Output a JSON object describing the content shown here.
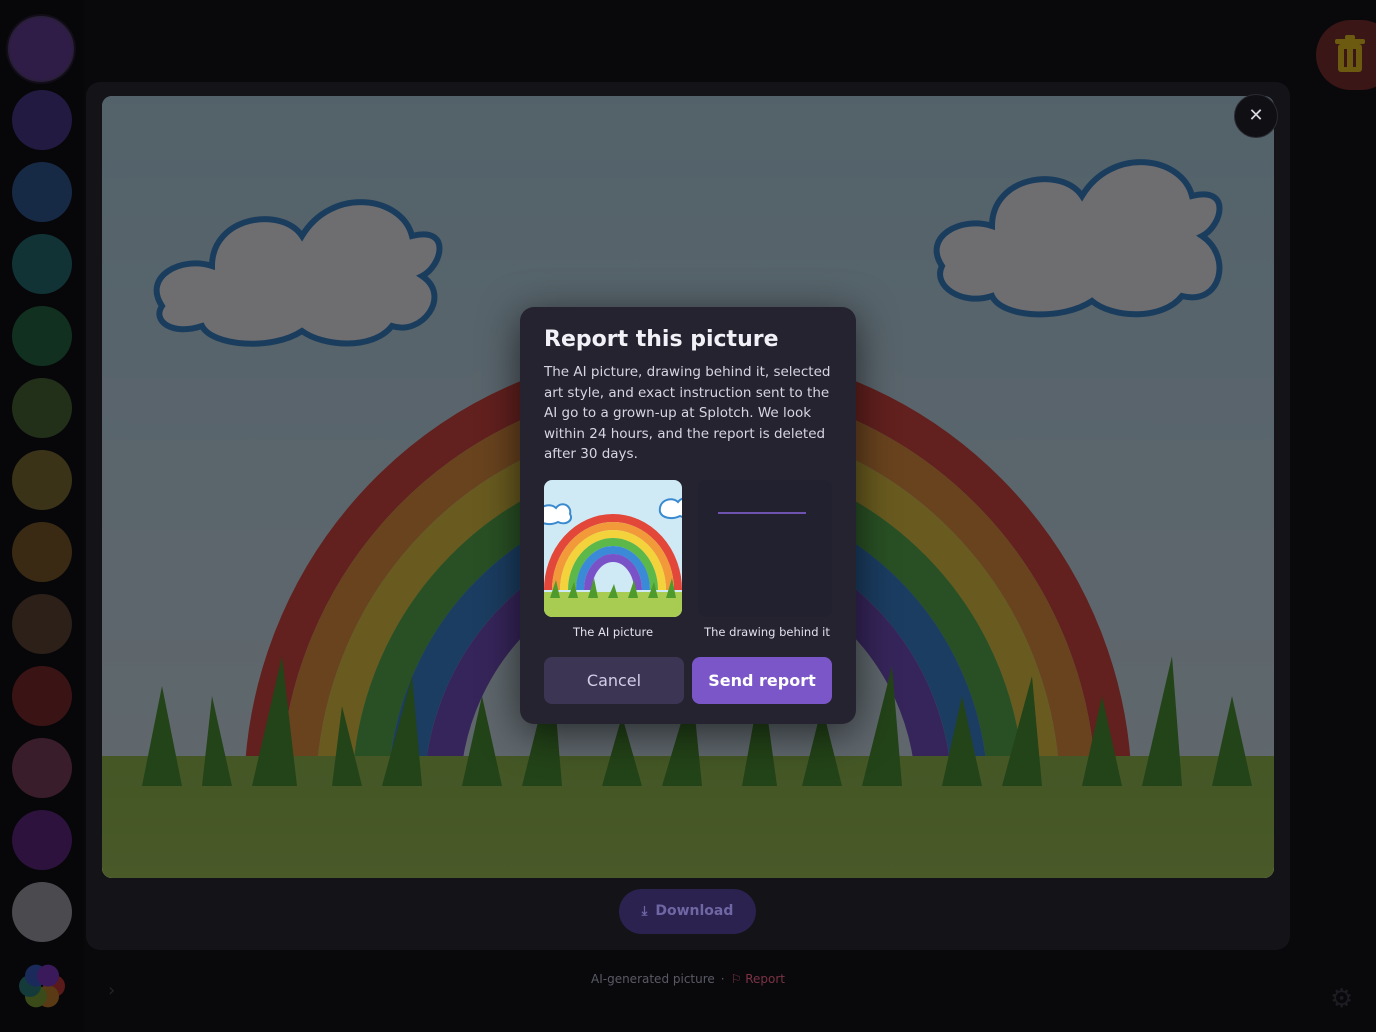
{
  "palette": {
    "swatches": [
      {
        "name": "purple-swatch",
        "color": "#2f1d48",
        "selected": true
      },
      {
        "name": "indigo-swatch",
        "color": "#231a42"
      },
      {
        "name": "navy-swatch",
        "color": "#172a45"
      },
      {
        "name": "teal-swatch",
        "color": "#113335"
      },
      {
        "name": "green-swatch",
        "color": "#12301f"
      },
      {
        "name": "olive-swatch",
        "color": "#22301a"
      },
      {
        "name": "mustard-swatch",
        "color": "#3a3318"
      },
      {
        "name": "amber-swatch",
        "color": "#3a2a14"
      },
      {
        "name": "brown-swatch",
        "color": "#2c2018"
      },
      {
        "name": "red-swatch",
        "color": "#3a1414"
      },
      {
        "name": "rose-swatch",
        "color": "#3a1d2a"
      },
      {
        "name": "violet-swatch",
        "color": "#2c123c"
      },
      {
        "name": "gray-swatch",
        "color": "#4a4a4f"
      }
    ]
  },
  "icons": {
    "trash": "trash-icon",
    "close": "close-icon",
    "download": "download-icon",
    "flag": "flag-icon",
    "gear": "gear-icon",
    "chevron": "chevron-right-icon"
  },
  "viewer": {
    "close_symbol": "✕",
    "download_label": "Download"
  },
  "footer": {
    "ai_label": "AI-generated picture",
    "separator": "·",
    "report_label": "Report"
  },
  "modal": {
    "title": "Report this picture",
    "description": "The AI picture, drawing behind it, selected art style, and exact instruction sent to the AI go to a grown-up at Splotch. We look within 24 hours, and the report is deleted after 30 days.",
    "ai_caption": "The AI picture",
    "drawing_caption": "The drawing behind it",
    "cancel_label": "Cancel",
    "send_label": "Send report"
  },
  "colors": {
    "accent": "#7a56c8",
    "modal_bg": "#24232f",
    "report_red": "#7a3344"
  }
}
